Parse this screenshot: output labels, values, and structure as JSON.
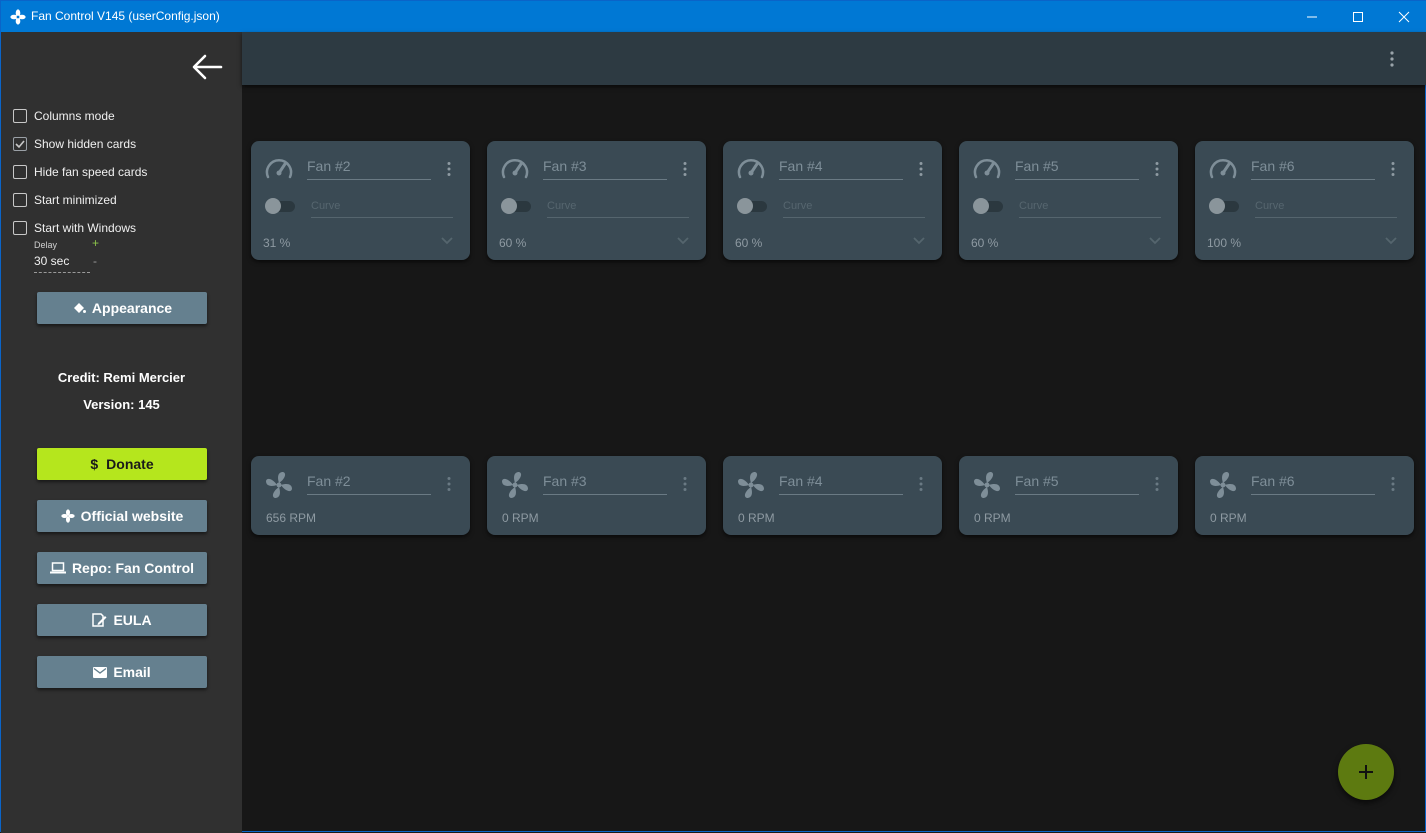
{
  "window": {
    "title": "Fan Control V145 (userConfig.json)",
    "icon": "fan-icon",
    "controls": [
      "minimize-icon",
      "maximize-icon",
      "close-icon"
    ],
    "accent": "#0078d4"
  },
  "sidebar": {
    "back_icon": "arrow-left-icon",
    "checkboxes": [
      {
        "label": "Columns mode",
        "checked": false
      },
      {
        "label": "Show hidden cards",
        "checked": true
      },
      {
        "label": "Hide fan speed cards",
        "checked": false
      },
      {
        "label": "Start minimized",
        "checked": false
      },
      {
        "label": "Start with Windows",
        "checked": false
      }
    ],
    "delay": {
      "label": "Delay",
      "value": "30 sec",
      "plus": "+",
      "minus": "-"
    },
    "appearance_label": "Appearance",
    "credit": "Credit: Remi Mercier",
    "version": "Version: 145",
    "buttons": {
      "donate": "Donate",
      "website": "Official website",
      "repo": "Repo: Fan Control",
      "eula": "EULA",
      "email": "Email"
    },
    "donate_color": "#b5e61d"
  },
  "control_cards": [
    {
      "name": "Fan #2",
      "curve_placeholder": "Curve",
      "value": "31 %"
    },
    {
      "name": "Fan #3",
      "curve_placeholder": "Curve",
      "value": "60 %"
    },
    {
      "name": "Fan #4",
      "curve_placeholder": "Curve",
      "value": "60 %"
    },
    {
      "name": "Fan #5",
      "curve_placeholder": "Curve",
      "value": "60 %"
    },
    {
      "name": "Fan #6",
      "curve_placeholder": "Curve",
      "value": "100 %"
    }
  ],
  "speed_cards": [
    {
      "name": "Fan #2",
      "value": "656 RPM"
    },
    {
      "name": "Fan #3",
      "value": "0 RPM"
    },
    {
      "name": "Fan #4",
      "value": "0 RPM"
    },
    {
      "name": "Fan #5",
      "value": "0 RPM"
    },
    {
      "name": "Fan #6",
      "value": "0 RPM"
    }
  ],
  "fab_icon": "plus-icon"
}
